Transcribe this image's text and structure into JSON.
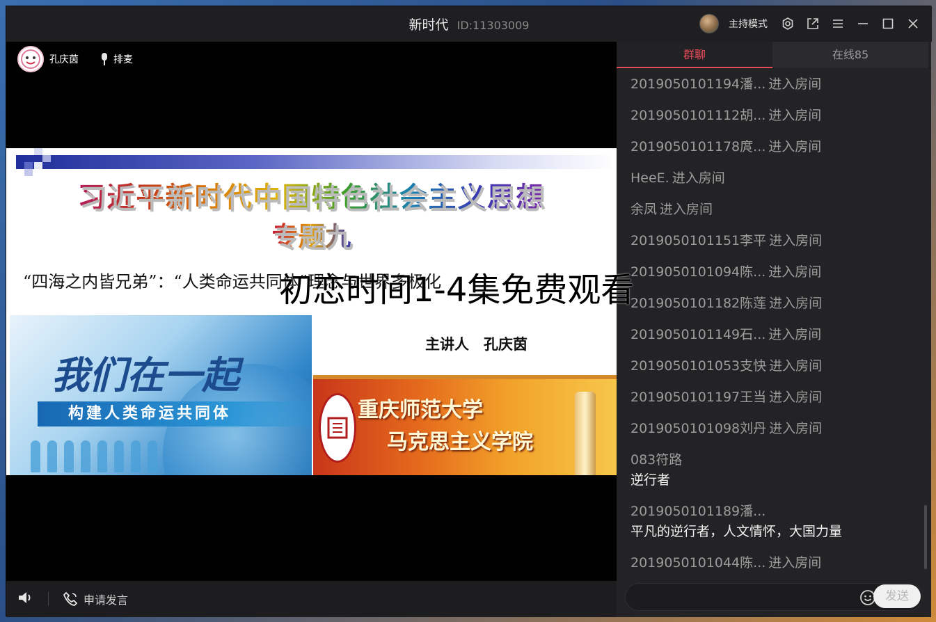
{
  "window": {
    "title": "新时代",
    "room_id": "ID:11303009",
    "host_mode_label": "主持模式"
  },
  "presenter": {
    "name": "孔庆茵",
    "mic_queue_label": "排麦"
  },
  "slide": {
    "title": "习近平新时代中国特色社会主义思想",
    "subtitle": "专题九",
    "quote": "“四海之内皆兄弟”：“人类命运共同体”理念与世界多极化",
    "lecturer": "主讲人　孔庆茵",
    "banner_script": "我们在一起",
    "banner_strip": "构建人类命运共同体",
    "school_line1": "重庆师范大学",
    "school_line2": "马克思主义学院"
  },
  "overlay_text": "初恋时间1-4集免费观看",
  "video_bottom": {
    "apply_speak_label": "申请发言"
  },
  "chat": {
    "tabs": [
      {
        "label": "群聊",
        "active": true
      },
      {
        "label": "在线85",
        "active": false
      }
    ],
    "entries": [
      {
        "who": "2019050101194潘...",
        "action": "进入房间"
      },
      {
        "who": "2019050101112胡...",
        "action": "进入房间"
      },
      {
        "who": "2019050101178庹...",
        "action": "进入房间"
      },
      {
        "who": "HeeE.",
        "action": "进入房间"
      },
      {
        "who": "余凤",
        "action": "进入房间"
      },
      {
        "who": "2019050101151李平",
        "action": "进入房间"
      },
      {
        "who": "2019050101094陈...",
        "action": "进入房间"
      },
      {
        "who": "2019050101182陈莲",
        "action": "进入房间"
      },
      {
        "who": "2019050101149石...",
        "action": "进入房间"
      },
      {
        "who": "2019050101053支快",
        "action": "进入房间"
      },
      {
        "who": "2019050101197王当",
        "action": "进入房间"
      },
      {
        "who": "2019050101098刘丹",
        "action": "进入房间"
      }
    ],
    "messages": [
      {
        "who": "083符路",
        "text": "逆行者"
      },
      {
        "who": "2019050101189潘...",
        "text": "平凡的逆行者，人文情怀，大国力量"
      }
    ],
    "last_entry": {
      "who": "2019050101044陈...",
      "action": "进入房间"
    },
    "send_label": "发送"
  },
  "colors": {
    "accent_red": "#e94a58",
    "panel_bg": "#232326",
    "video_bg": "#000000"
  }
}
